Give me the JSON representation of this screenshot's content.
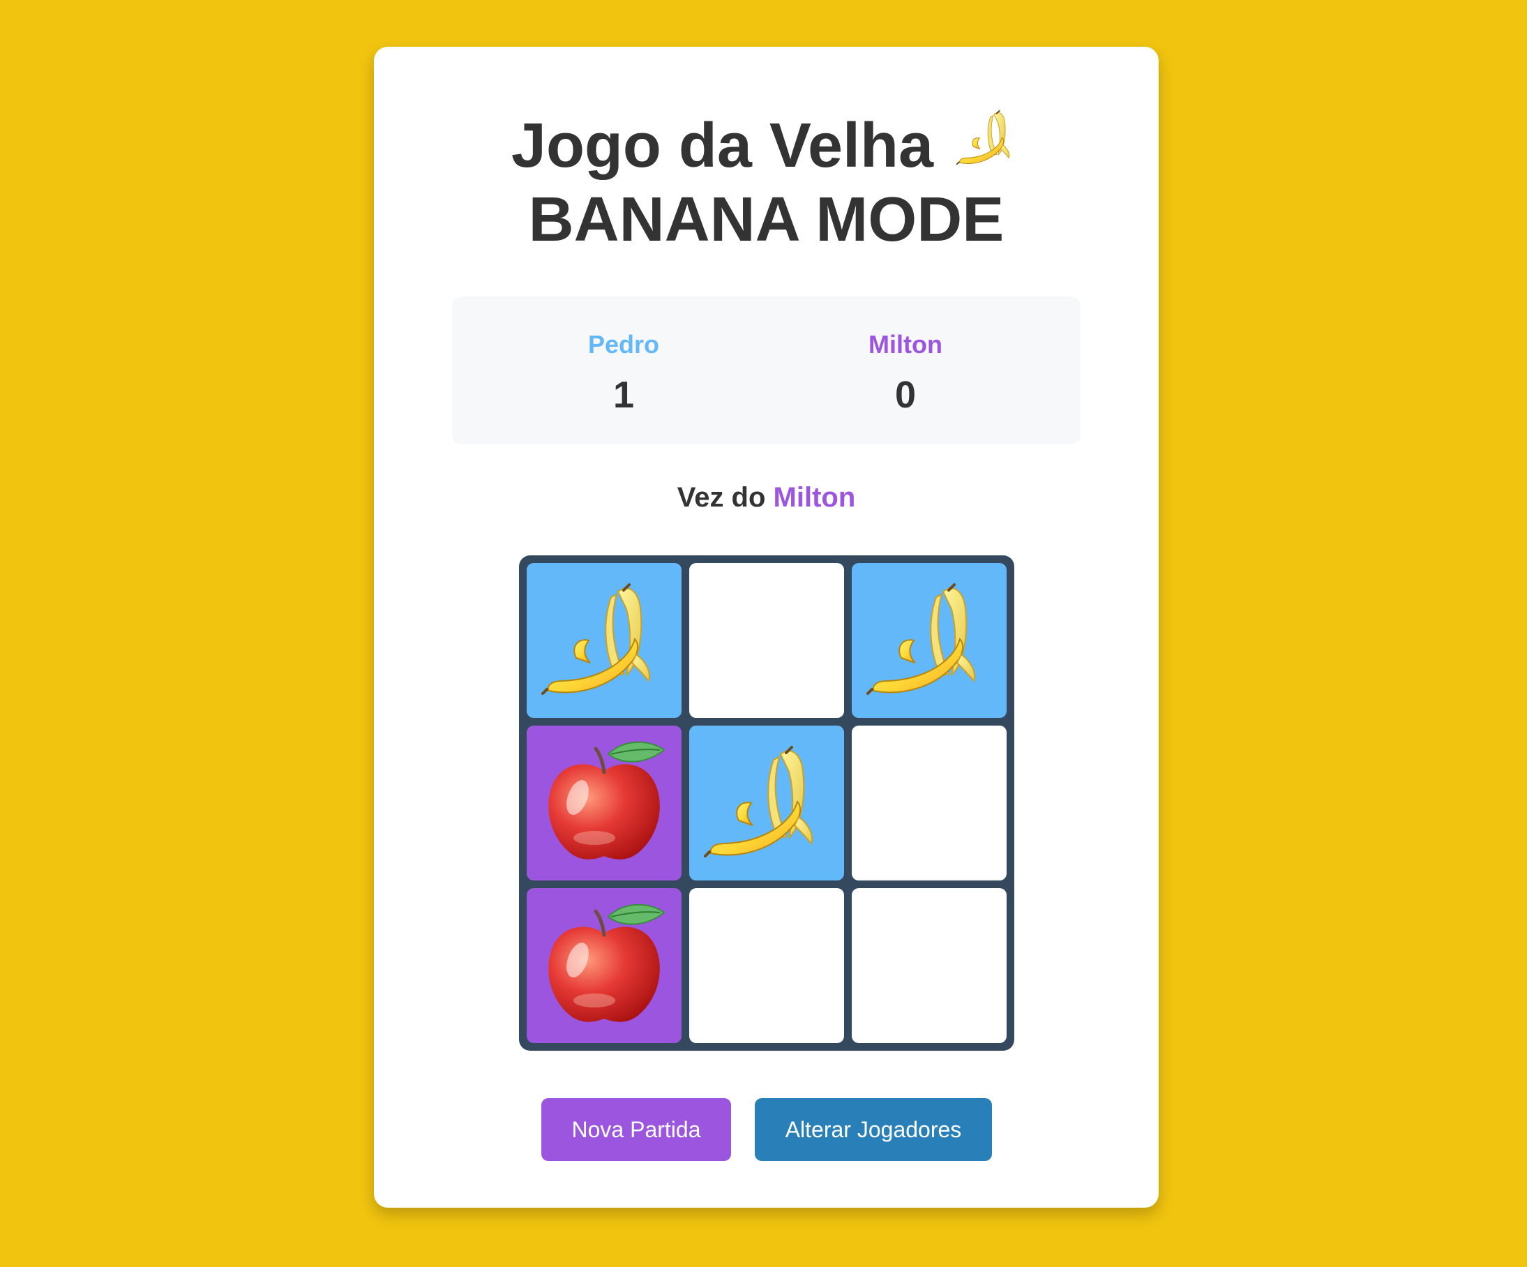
{
  "colors": {
    "background": "#f1c40f",
    "player1": "#63b8fa",
    "player2": "#9b55de",
    "board": "#34495e",
    "button_new": "#9b55de",
    "button_change": "#2980b9"
  },
  "header": {
    "title_line1": "Jogo da Velha",
    "title_icon": "banana-icon",
    "title_line2": "BANANA MODE"
  },
  "scoreboard": {
    "player1": {
      "name": "Pedro",
      "score": "1",
      "piece": "banana-icon"
    },
    "player2": {
      "name": "Milton",
      "score": "0",
      "piece": "apple-icon"
    }
  },
  "turn": {
    "prefix": "Vez do ",
    "player": "Milton"
  },
  "board": {
    "cells": [
      "banana",
      "",
      "banana",
      "apple",
      "banana",
      "",
      "apple",
      "",
      ""
    ]
  },
  "controls": {
    "new_game_label": "Nova Partida",
    "change_players_label": "Alterar Jogadores"
  }
}
